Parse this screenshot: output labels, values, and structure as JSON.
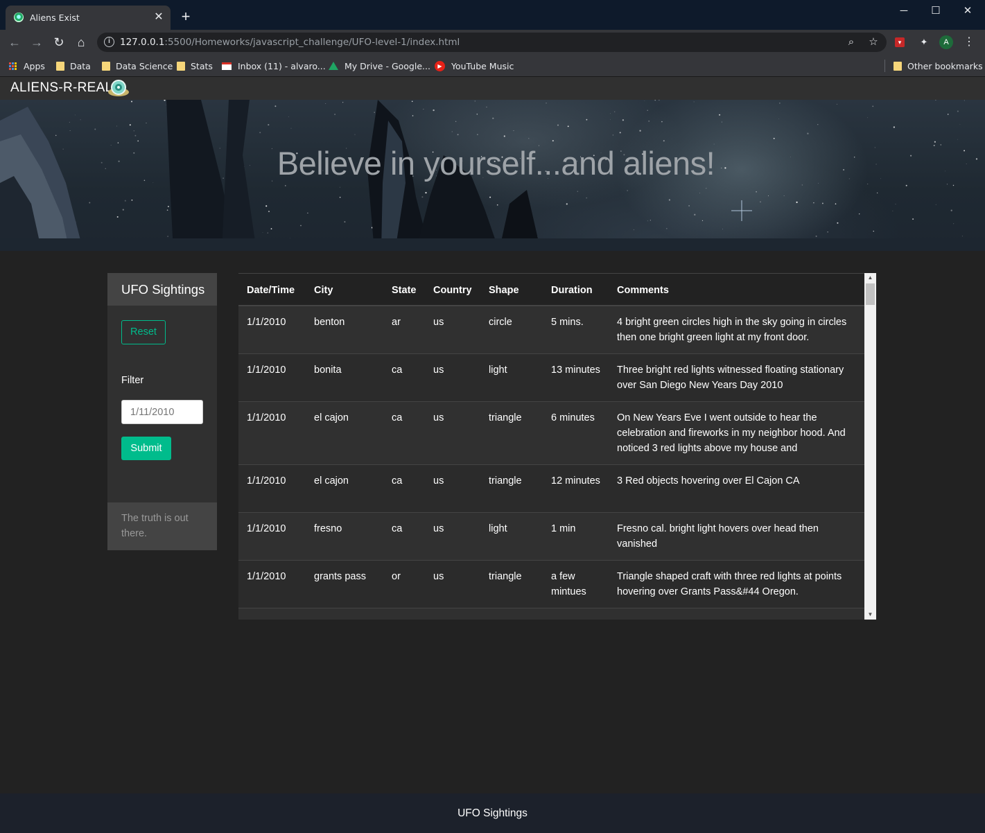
{
  "browser": {
    "tab_title": "Aliens Exist",
    "url_host": "127.0.0.1",
    "url_rest": ":5500/Homeworks/javascript_challenge/UFO-level-1/index.html",
    "bookmarks": [
      "Apps",
      "Data",
      "Data Science",
      "Stats",
      "Inbox (11) - alvaro...",
      "My Drive - Google...",
      "YouTube Music"
    ],
    "other_bookmarks": "Other bookmarks",
    "profile_initial": "A"
  },
  "navbar": {
    "brand": "ALIENS-R-REAL"
  },
  "hero": {
    "headline": "Believe in yourself...and aliens!"
  },
  "sidebar": {
    "title": "UFO Sightings",
    "reset_label": "Reset",
    "filter_label": "Filter",
    "filter_placeholder": "1/11/2010",
    "submit_label": "Submit",
    "footer_text": "The truth is out there."
  },
  "table": {
    "headers": [
      "Date/Time",
      "City",
      "State",
      "Country",
      "Shape",
      "Duration",
      "Comments"
    ],
    "rows": [
      [
        "1/1/2010",
        "benton",
        "ar",
        "us",
        "circle",
        "5 mins.",
        "4 bright green circles high in the sky going in circles then one bright green light at my front door."
      ],
      [
        "1/1/2010",
        "bonita",
        "ca",
        "us",
        "light",
        "13 minutes",
        "Three bright red lights witnessed floating stationary over San Diego New Years Day 2010"
      ],
      [
        "1/1/2010",
        "el cajon",
        "ca",
        "us",
        "triangle",
        "6 minutes",
        "On New Years Eve I went outside to hear the celebration and fireworks in my neighbor hood. And noticed 3 red lights above my house and"
      ],
      [
        "1/1/2010",
        "el cajon",
        "ca",
        "us",
        "triangle",
        "12 minutes",
        "3 Red objects hovering over El Cajon CA"
      ],
      [
        "1/1/2010",
        "fresno",
        "ca",
        "us",
        "light",
        "1 min",
        "Fresno cal. bright light hovers over head then vanished"
      ],
      [
        "1/1/2010",
        "grants pass",
        "or",
        "us",
        "triangle",
        "a few mintues",
        "Triangle shaped craft with three red lights at points hovering over Grants Pass&#44 Oregon."
      ]
    ]
  },
  "footer": {
    "text": "UFO Sightings"
  },
  "colors": {
    "accent": "#00bc8c",
    "page_bg": "#222222",
    "card_bg": "#303030",
    "footer_bg": "#1c212b"
  }
}
